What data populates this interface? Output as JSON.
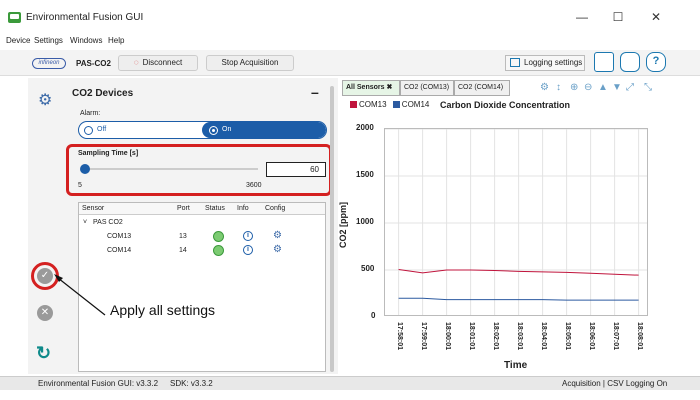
{
  "window": {
    "title": "Environmental Fusion GUI",
    "minimize": "—",
    "maximize": "☐",
    "close": "✕"
  },
  "menu": [
    "Device",
    "Settings",
    "Windows",
    "Help"
  ],
  "toolbar": {
    "logo_text": "infineon",
    "device": "PAS-CO2",
    "disconnect": "Disconnect",
    "stop": "Stop Acquisition",
    "logging": "Logging settings"
  },
  "panel": {
    "title": "CO2 Devices",
    "alarm_label": "Alarm:",
    "alarm_off": "Off",
    "alarm_on": "On",
    "sampling_label": "Sampling Time [s]",
    "sampling_value": "60",
    "sampling_min": "5",
    "sampling_max": "3600",
    "sampling_fraction": 0.0
  },
  "sensor_table": {
    "headers": [
      "Sensor",
      "Port",
      "Status",
      "Info",
      "Config"
    ],
    "group": "PAS CO2",
    "rows": [
      {
        "name": "COM13",
        "port": "13"
      },
      {
        "name": "COM14",
        "port": "14"
      }
    ]
  },
  "annotation": "Apply all settings",
  "chart_tabs": [
    "All Sensors",
    "CO2 (COM13)",
    "CO2 (COM14)"
  ],
  "chart_data": {
    "type": "line",
    "title": "Carbon Dioxide Concentration",
    "xlabel": "Time",
    "ylabel": "CO2 [ppm]",
    "ylim": [
      0,
      2000
    ],
    "yticks": [
      "0",
      "500",
      "1000",
      "1500",
      "2000"
    ],
    "x": [
      "17:58:01",
      "17:59:01",
      "18:00:01",
      "18:01:01",
      "18:02:01",
      "18:03:01",
      "18:04:01",
      "18:05:01",
      "18:06:01",
      "18:07:01",
      "18:08:01"
    ],
    "series": [
      {
        "name": "COM13",
        "color": "#c0143c",
        "values": [
          505,
          470,
          500,
          500,
          495,
          485,
          480,
          475,
          465,
          455,
          445
        ]
      },
      {
        "name": "COM14",
        "color": "#2c5aa0",
        "values": [
          200,
          200,
          185,
          185,
          185,
          185,
          185,
          180,
          180,
          180,
          180
        ]
      }
    ],
    "grid": true
  },
  "statusbar": {
    "left": "Environmental Fusion GUI: v3.3.2",
    "sdk": "SDK: v3.3.2",
    "right": "Acquisition | CSV Logging On"
  }
}
